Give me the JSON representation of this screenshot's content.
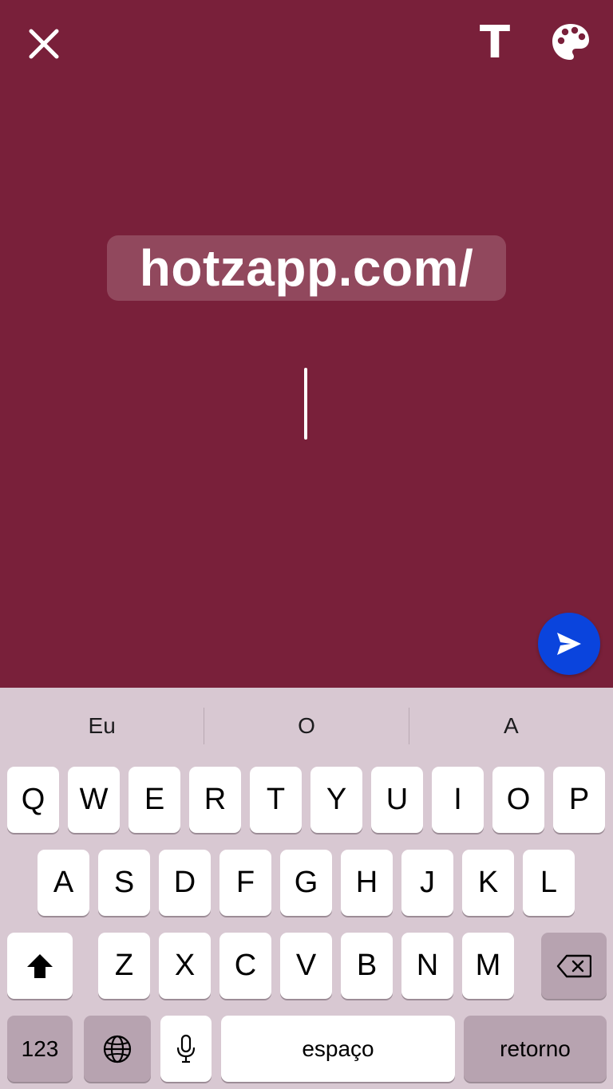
{
  "editor": {
    "background_color": "#79203a",
    "link_text": "hotzapp.com/",
    "close_icon": "close-icon",
    "text_tool_label": "T",
    "palette_icon": "palette-icon",
    "send_icon": "send-icon",
    "send_color": "#0a44dd"
  },
  "keyboard": {
    "suggestions": [
      "Eu",
      "O",
      "A"
    ],
    "row1": [
      "Q",
      "W",
      "E",
      "R",
      "T",
      "Y",
      "U",
      "I",
      "O",
      "P"
    ],
    "row2": [
      "A",
      "S",
      "D",
      "F",
      "G",
      "H",
      "J",
      "K",
      "L"
    ],
    "row3": [
      "Z",
      "X",
      "C",
      "V",
      "B",
      "N",
      "M"
    ],
    "shift_icon": "shift-icon",
    "backspace_icon": "backspace-icon",
    "numbers_label": "123",
    "globe_icon": "globe-icon",
    "mic_icon": "microphone-icon",
    "space_label": "espaço",
    "return_label": "retorno"
  }
}
